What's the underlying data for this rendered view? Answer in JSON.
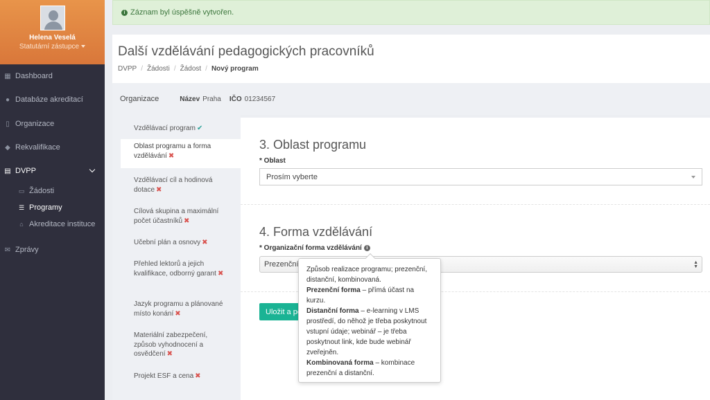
{
  "alert": {
    "text": "Záznam byl úspěšně vytvořen."
  },
  "user": {
    "name": "Helena Veselá",
    "role": "Statutární zástupce"
  },
  "sidebar": {
    "items": [
      {
        "label": "Dashboard",
        "icon": "dashboard-icon"
      },
      {
        "label": "Databáze akreditací",
        "icon": "globe-icon"
      },
      {
        "label": "Organizace",
        "icon": "building-icon"
      },
      {
        "label": "Rekvalifikace",
        "icon": "graduation-cap-icon"
      },
      {
        "label": "DVPP",
        "icon": "book-icon"
      },
      {
        "label": "Zprávy",
        "icon": "envelope-icon"
      }
    ],
    "dvpp_sub": [
      {
        "label": "Žádosti",
        "icon": "file-icon"
      },
      {
        "label": "Programy",
        "icon": "list-icon"
      },
      {
        "label": "Akreditace instituce",
        "icon": "institution-icon"
      }
    ]
  },
  "header": {
    "title": "Další vzdělávání pedagogických pracovníků",
    "breadcrumb": [
      "DVPP",
      "Žádosti",
      "Žádost",
      "Nový program"
    ]
  },
  "org": {
    "label": "Organizace",
    "name_key": "Název",
    "name_value": "Praha",
    "ico_key": "IČO",
    "ico_value": "01234567"
  },
  "steps": [
    {
      "label": "Vzdělávací program",
      "status": "done"
    },
    {
      "label": "Oblast programu a forma vzdělávání",
      "status": "todo"
    },
    {
      "label": "Vzdělávací cíl a hodinová dotace",
      "status": "todo"
    },
    {
      "label": "Cílová skupina a maximální počet účastníků",
      "status": "todo"
    },
    {
      "label": "Učební plán a osnovy",
      "status": "todo"
    },
    {
      "label": "Přehled lektorů a jejich kvalifikace, odborný garant",
      "status": "todo"
    },
    {
      "label": "Jazyk programu a plánované místo konání",
      "status": "todo"
    },
    {
      "label": "Materiální zabezpečení, způsob vyhodnocení a osvědčení",
      "status": "todo"
    },
    {
      "label": "Projekt ESF a cena",
      "status": "todo"
    }
  ],
  "section3": {
    "title": "3. Oblast programu",
    "field_label": "* Oblast",
    "select_value": "Prosím vyberte"
  },
  "section4": {
    "title": "4. Forma vzdělávání",
    "field_label": "* Organizační forma vzdělávání",
    "select_value": "Prezenční"
  },
  "save_button": {
    "label": "Uložit a pokračovat"
  },
  "tooltip": {
    "intro": "Způsob realizace programu; prezenční, distanční, kombinovaná.",
    "items": [
      {
        "term": "Prezenční forma",
        "desc": " – přímá účast na kurzu."
      },
      {
        "term": "Distanční forma",
        "desc": " – e-learning v LMS prostředí, do něhož je třeba poskytnout vstupní údaje; webinář – je třeba poskytnout link, kde bude webinář zveřejněn."
      },
      {
        "term": "Kombinovaná forma",
        "desc": " – kombinace prezenční a distanční."
      }
    ]
  },
  "colors": {
    "sidebar_bg": "#2f2f3d",
    "profile_bg": "#e0873f",
    "accent": "#1ab394",
    "alert_bg": "#dff0d8",
    "error": "#d9534f"
  }
}
